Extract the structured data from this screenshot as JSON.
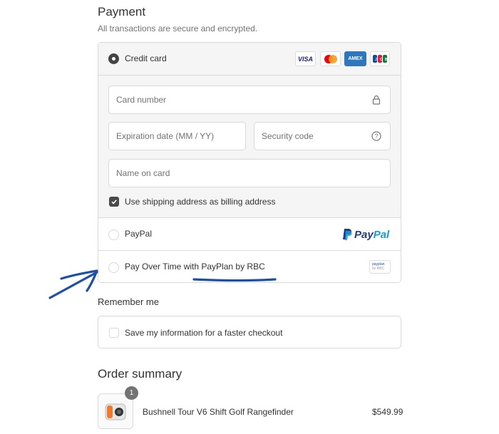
{
  "payment": {
    "title": "Payment",
    "subtitle": "All transactions are secure and encrypted.",
    "credit_card": {
      "label": "Credit card",
      "selected": true,
      "logos": [
        {
          "name": "visa-icon",
          "text": "VISA",
          "color": "#1a1f71"
        },
        {
          "name": "mastercard-icon",
          "text": "",
          "color": "#eb001b"
        },
        {
          "name": "amex-icon",
          "text": "AMEX",
          "color": "#2e77bc"
        },
        {
          "name": "jcb-icon",
          "text": "JCB",
          "color": "#0b7e3e"
        }
      ]
    },
    "fields": {
      "card_number_placeholder": "Card number",
      "expiration_placeholder": "Expiration date (MM / YY)",
      "security_code_placeholder": "Security code",
      "name_on_card_placeholder": "Name on card"
    },
    "billing_checkbox": {
      "label": "Use shipping address as billing address",
      "checked": true
    },
    "paypal": {
      "label": "PayPal",
      "logo_text_pay": "Pay",
      "logo_text_pal": "Pal",
      "selected": false
    },
    "payplan": {
      "label": "Pay Over Time with PayPlan by RBC",
      "logo_text": "payplan",
      "logo_subtext": "by RBC",
      "selected": false
    }
  },
  "remember": {
    "title": "Remember me",
    "checkbox_label": "Save my information for a faster checkout",
    "checked": false
  },
  "order_summary": {
    "title": "Order summary",
    "items": [
      {
        "name": "Bushnell Tour V6 Shift Golf Rangefinder",
        "price": "$549.99",
        "quantity": "1"
      }
    ]
  },
  "colors": {
    "annotation_blue": "#1e4fa8",
    "paypal_dark": "#253b80",
    "paypal_light": "#179bd7"
  }
}
